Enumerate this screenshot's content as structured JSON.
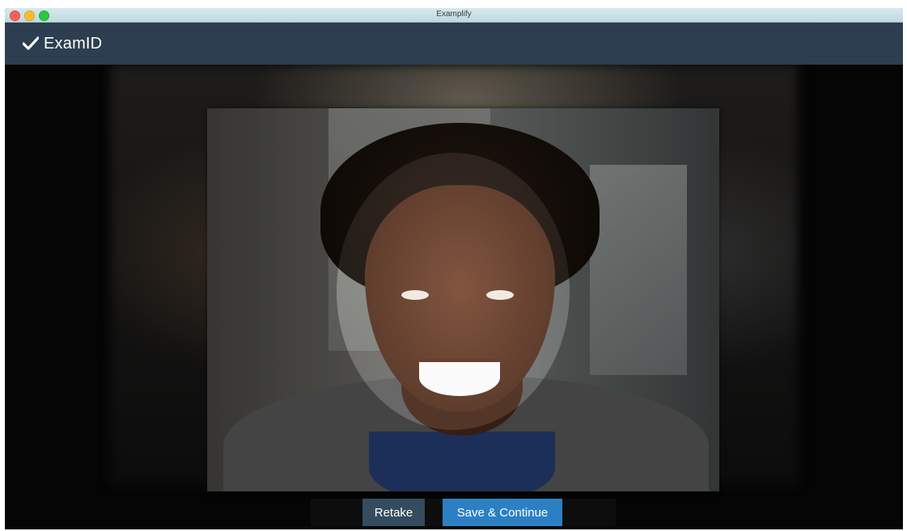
{
  "window": {
    "title": "Examplify"
  },
  "app": {
    "logo_text": "ExamID"
  },
  "icons": {
    "logo": "checkmark-shield-icon"
  },
  "actions": {
    "retake_label": "Retake",
    "save_label": "Save & Continue"
  },
  "colors": {
    "appbar": "#2c3e50",
    "retake": "#354b5f",
    "save": "#2d7fc4"
  }
}
